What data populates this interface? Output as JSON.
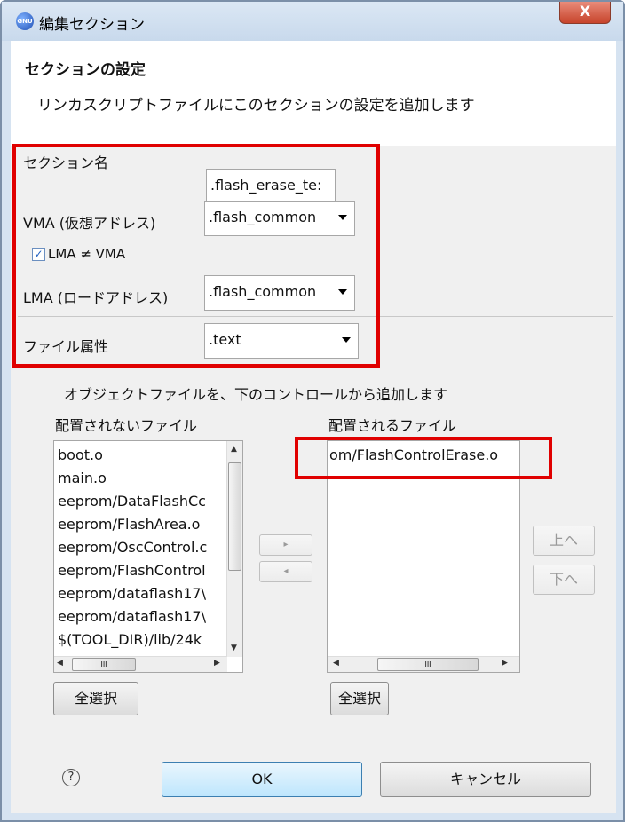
{
  "window": {
    "title": "編集セクション",
    "close_label": "X",
    "app_icon_text": "GNU"
  },
  "header": {
    "title": "セクションの設定",
    "description": "リンカスクリプトファイルにこのセクションの設定を追加します"
  },
  "form": {
    "section_name_label": "セクション名",
    "section_name_value": ".flash_erase_te:",
    "vma_label": "VMA (仮想アドレス)",
    "vma_value": ".flash_common",
    "lma_checkbox_label": "LMA ≠ VMA",
    "lma_checked": true,
    "lma_label": "LMA (ロードアドレス)",
    "lma_value": ".flash_common",
    "file_attr_label": "ファイル属性",
    "file_attr_value": ".text"
  },
  "objects": {
    "instruction": "オブジェクトファイルを、下のコントロールから追加します",
    "unplaced_label": "配置されないファイル",
    "placed_label": "配置されるファイル",
    "unplaced_files": [
      "boot.o",
      "main.o",
      "eeprom/DataFlashCc",
      "eeprom/FlashArea.o",
      "eeprom/OscControl.c",
      "eeprom/FlashControl",
      "eeprom/dataflash17\\",
      "eeprom/dataflash17\\",
      "$(TOOL_DIR)/lib/24k"
    ],
    "placed_files": [
      "om/FlashControlErase.o"
    ],
    "move_right": "▸",
    "move_left": "◂",
    "up_label": "上へ",
    "down_label": "下へ",
    "select_all_label": "全選択",
    "hscroll_grip": "III"
  },
  "footer": {
    "help_icon": "?",
    "ok_label": "OK",
    "cancel_label": "キャンセル"
  }
}
